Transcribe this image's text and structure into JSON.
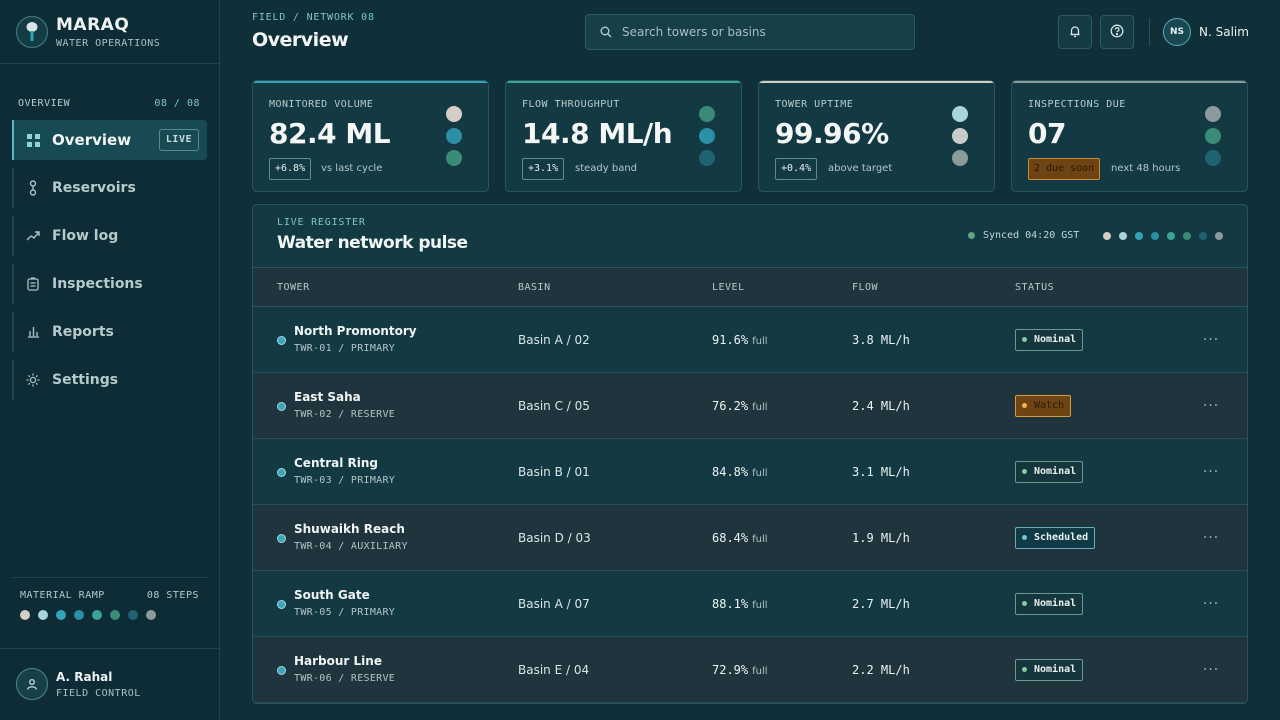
{
  "brand": {
    "name": "MARAQ",
    "subtitle": "WATER OPERATIONS"
  },
  "nav": {
    "section_label": "OVERVIEW",
    "section_count": "08 / 08",
    "items": [
      {
        "label": "Overview",
        "icon": "grid-icon",
        "badge": "LIVE",
        "active": true
      },
      {
        "label": "Reservoirs",
        "icon": "reservoir-icon"
      },
      {
        "label": "Flow log",
        "icon": "trend-icon"
      },
      {
        "label": "Inspections",
        "icon": "clipboard-icon"
      },
      {
        "label": "Reports",
        "icon": "bar-chart-icon"
      },
      {
        "label": "Settings",
        "icon": "gear-icon"
      }
    ]
  },
  "material_ramp": {
    "label": "MATERIAL RAMP",
    "steps_label": "08 STEPS",
    "colors": [
      "#d6cec4",
      "#a8d4dc",
      "#34a3b8",
      "#2b8fa6",
      "#3aa495",
      "#3b8c76",
      "#1f6272",
      "#8d9a9c"
    ]
  },
  "footer_user": {
    "name": "A. Rahal",
    "role": "FIELD CONTROL"
  },
  "header": {
    "breadcrumb": "FIELD / NETWORK 08",
    "title": "Overview",
    "search_placeholder": "Search towers or basins",
    "user_initials": "NS",
    "user_name": "N. Salim"
  },
  "kpis": [
    {
      "label": "MONITORED VOLUME",
      "value": "82.4 ML",
      "delta": "+6.8%",
      "note": "vs last cycle",
      "accent": "#34a3b8",
      "dots": [
        "#d6cec4",
        "#2b8fa6",
        "#3b8c76"
      ]
    },
    {
      "label": "FLOW THROUGHPUT",
      "value": "14.8 ML/h",
      "delta": "+3.1%",
      "note": "steady band",
      "accent": "#3aa495",
      "dots": [
        "#3b8c76",
        "#2b8fa6",
        "#1f6272"
      ]
    },
    {
      "label": "TOWER UPTIME",
      "value": "99.96%",
      "delta": "+0.4%",
      "note": "above target",
      "accent": "#d6cec4",
      "dots": [
        "#a8d4dc",
        "#c9cdc6",
        "#8d9a9c"
      ]
    },
    {
      "label": "INSPECTIONS DUE",
      "value": "07",
      "delta": "2 due soon",
      "note": "next 48 hours",
      "accent": "#8d9a9c",
      "warn": true,
      "dots": [
        "#8d9a9c",
        "#3b8c76",
        "#1f6272"
      ]
    }
  ],
  "register": {
    "eyebrow": "LIVE REGISTER",
    "title": "Water network pulse",
    "sync": "Synced 04:20 GST",
    "swatches": [
      "#d6cec4",
      "#a8d4dc",
      "#34a3b8",
      "#2b8fa6",
      "#3aa495",
      "#3b8c76",
      "#1f6272",
      "#8d9a9c"
    ],
    "columns": [
      "TOWER",
      "BASIN",
      "LEVEL",
      "FLOW",
      "STATUS"
    ],
    "level_unit": "full",
    "rows": [
      {
        "name": "North Promontory",
        "code": "TWR-01 / PRIMARY",
        "basin": "Basin A / 02",
        "level": "91.6%",
        "flow": "3.8 ML/h",
        "status": "Nominal"
      },
      {
        "name": "East Saha",
        "code": "TWR-02 / RESERVE",
        "basin": "Basin C / 05",
        "level": "76.2%",
        "flow": "2.4 ML/h",
        "status": "Watch"
      },
      {
        "name": "Central Ring",
        "code": "TWR-03 / PRIMARY",
        "basin": "Basin B / 01",
        "level": "84.8%",
        "flow": "3.1 ML/h",
        "status": "Nominal"
      },
      {
        "name": "Shuwaikh Reach",
        "code": "TWR-04 / AUXILIARY",
        "basin": "Basin D / 03",
        "level": "68.4%",
        "flow": "1.9 ML/h",
        "status": "Scheduled"
      },
      {
        "name": "South Gate",
        "code": "TWR-05 / PRIMARY",
        "basin": "Basin A / 07",
        "level": "88.1%",
        "flow": "2.7 ML/h",
        "status": "Nominal"
      },
      {
        "name": "Harbour Line",
        "code": "TWR-06 / RESERVE",
        "basin": "Basin E / 04",
        "level": "72.9%",
        "flow": "2.2 ML/h",
        "status": "Nominal"
      }
    ]
  }
}
